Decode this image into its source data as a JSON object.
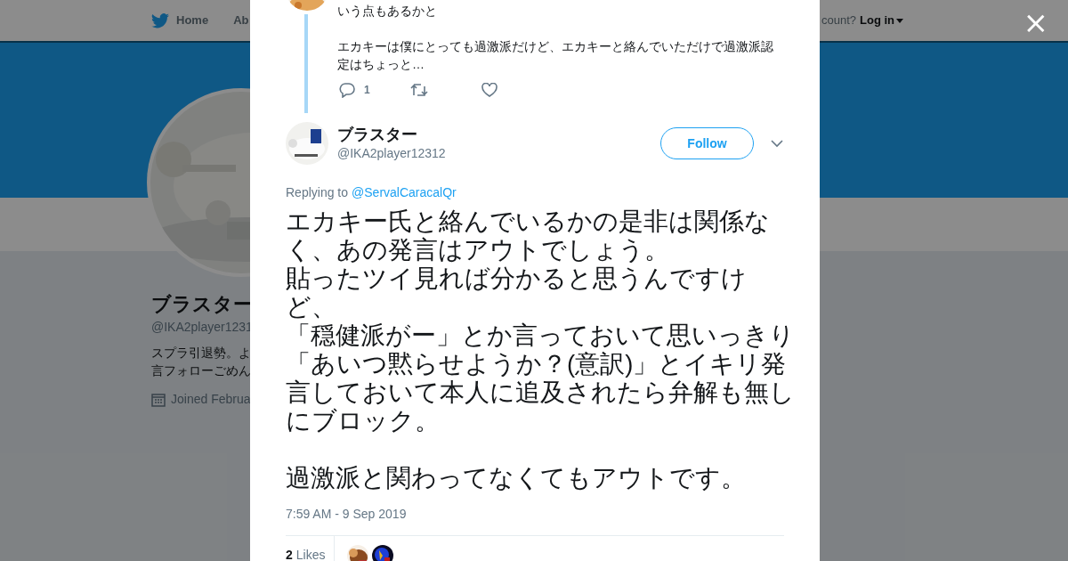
{
  "background_page": {
    "nav": {
      "items": [
        "Home",
        "Ab"
      ],
      "account_prompt": "count?",
      "login": "Log in"
    },
    "profile": {
      "name": "ブラスター",
      "handle": "@IKA2player1231",
      "bio_lines": [
        "スプラ引退勢。よ",
        "言フォローごめん"
      ],
      "joined": "Joined Februa"
    }
  },
  "modal": {
    "close": "×",
    "previous_tweet": {
      "paragraphs": [
        "いう点もあるかと",
        "エカキーは僕にとっても過激派だけど、エカキーと絡んでいただけで過激派認定はちょっと…"
      ],
      "reply_count": "1"
    },
    "tweet": {
      "name": "ブラスター",
      "handle": "@IKA2player12312",
      "follow": "Follow",
      "replying_label": "Replying to",
      "replying_to": "@ServalCaracalQr",
      "paragraphs": [
        [
          "エカキー氏と絡んでいるかの是非は関係なく、あの発言はアウトでしょう。",
          "貼ったツイ見れば分かると思うんですけど、",
          "「穏健派がー」とか言っておいて思いっきり「あいつ黙らせようか？(意訳)」とイキリ発言しておいて本人に追及されたら弁解も無しにブロック。"
        ],
        [
          "過激派と関わってなくてもアウトです。"
        ]
      ],
      "timestamp": "7:59 AM - 9 Sep 2019",
      "likes_count": "2",
      "likes_label": "Likes"
    }
  }
}
